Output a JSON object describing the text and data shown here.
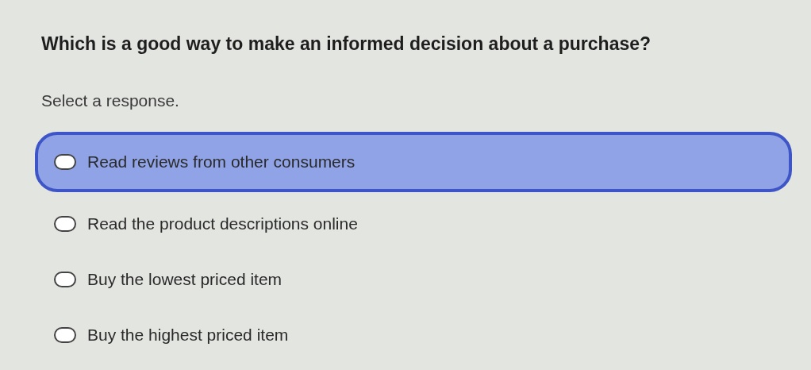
{
  "question": "Which is a good way to make an informed decision about a purchase?",
  "instruction": "Select a response.",
  "options": [
    {
      "label": "Read reviews from other consumers",
      "selected": false,
      "highlighted": true
    },
    {
      "label": "Read the product descriptions online",
      "selected": false,
      "highlighted": false
    },
    {
      "label": "Buy the lowest priced item",
      "selected": false,
      "highlighted": false
    },
    {
      "label": "Buy the highest priced item",
      "selected": false,
      "highlighted": false
    }
  ]
}
